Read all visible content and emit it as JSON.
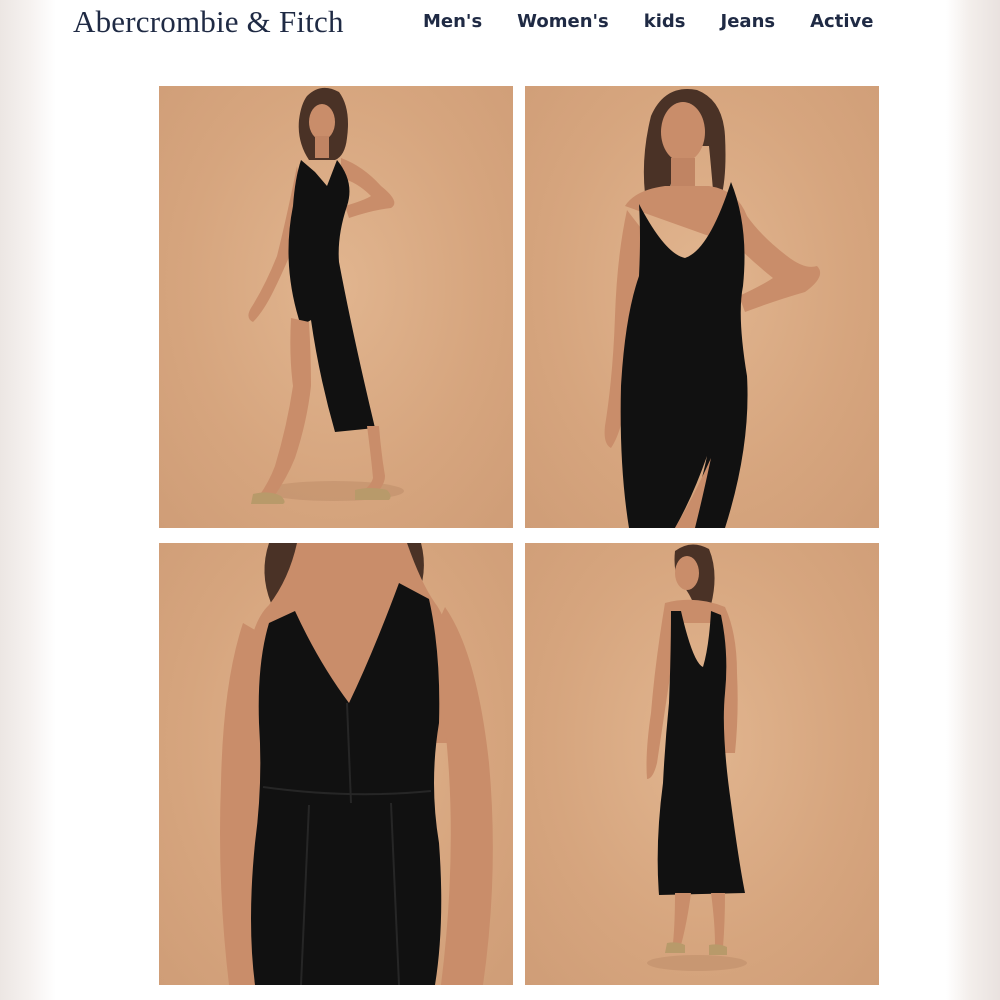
{
  "brand": {
    "name": "Abercrombie & Fitch"
  },
  "nav": {
    "items": [
      "Men's",
      "Women's",
      "kids",
      "Jeans",
      "Active"
    ]
  },
  "colors": {
    "brand_text": "#1f2a44",
    "backdrop": "#d9a882",
    "dress": "#0f0f0f",
    "skin": "#c98d6a"
  },
  "gallery": {
    "images": [
      {
        "name": "front-side-walking-view"
      },
      {
        "name": "front-hand-on-hip-view"
      },
      {
        "name": "bodice-closeup-view"
      },
      {
        "name": "back-view"
      }
    ]
  }
}
